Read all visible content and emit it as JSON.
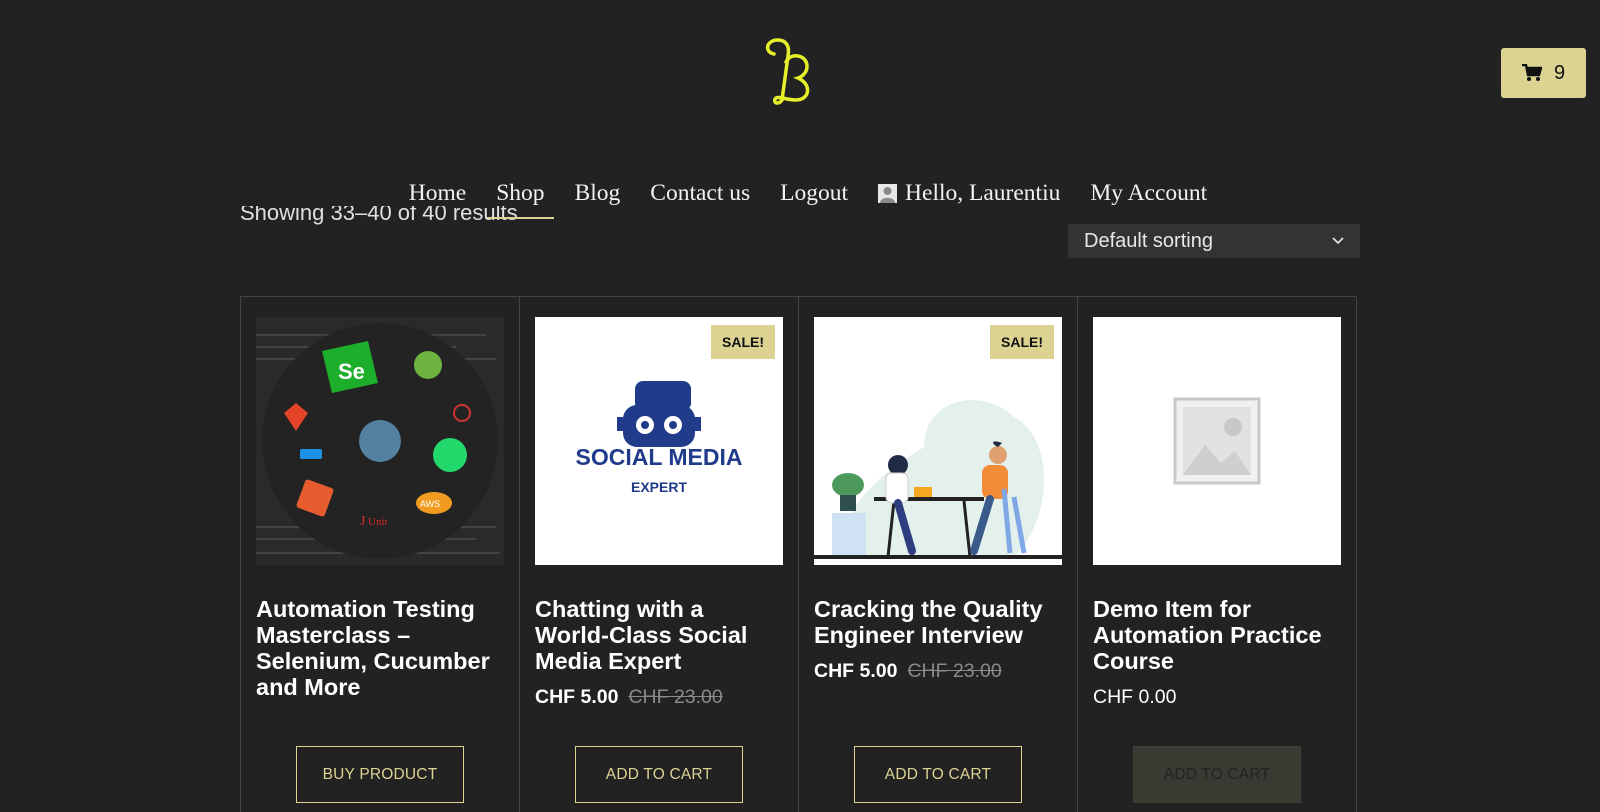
{
  "header": {
    "logo_letter": "B",
    "cart": {
      "icon": "cart-icon",
      "count": "9"
    }
  },
  "nav": {
    "items": [
      {
        "label": "Home"
      },
      {
        "label": "Shop",
        "active": true
      },
      {
        "label": "Blog"
      },
      {
        "label": "Contact us"
      },
      {
        "label": "Logout"
      },
      {
        "label": "Hello, Laurentiu",
        "icon": "avatar-icon"
      },
      {
        "label": "My Account"
      }
    ]
  },
  "shop": {
    "result_count": "Showing 33–40 of 40 results",
    "sorting": {
      "selected": "Default sorting",
      "icon": "chevron-down-icon"
    }
  },
  "products": [
    {
      "title": "Automation Testing Masterclass – Selenium, Cucumber and More",
      "image": "automation-tools-collage",
      "button": "BUY PRODUCT"
    },
    {
      "title": "Chatting with a World-Class Social Media Expert",
      "image": "social-media-expert-robot",
      "image_text_1": "SOCIAL MEDIA",
      "image_text_2": "EXPERT",
      "badge": "SALE!",
      "price_now": "CHF 5.00",
      "price_was": "CHF 23.00",
      "button": "ADD TO CART"
    },
    {
      "title": "Cracking the Quality Engineer Interview",
      "image": "interview-illustration",
      "badge": "SALE!",
      "price_now": "CHF 5.00",
      "price_was": "CHF 23.00",
      "button": "ADD TO CART"
    },
    {
      "title": "Demo Item for Automation Practice Course",
      "image": "placeholder-image",
      "price": "CHF 0.00",
      "button": "ADD TO CART",
      "button_state": "disabled"
    }
  ],
  "colors": {
    "background": "#222222",
    "accent": "#dcd393",
    "logo": "#e6f02a"
  }
}
